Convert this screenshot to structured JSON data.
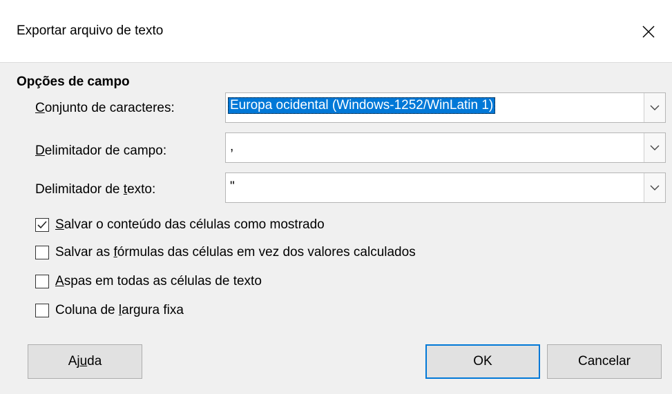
{
  "dialog": {
    "title": "Exportar arquivo de texto",
    "section_title": "Opções de campo"
  },
  "fields": [
    {
      "label_pre": "",
      "label_u": "C",
      "label_post": "onjunto de caracteres:",
      "value": "Europa ocidental (Windows-1252/WinLatin 1)"
    },
    {
      "label_pre": "",
      "label_u": "D",
      "label_post": "elimitador de campo:",
      "value": ","
    },
    {
      "label_pre": "Delimitador de ",
      "label_u": "t",
      "label_post": "exto:",
      "value": "\""
    }
  ],
  "options": [
    {
      "pre": "",
      "u": "S",
      "post": "alvar o conteúdo das células como mostrado",
      "checked": true
    },
    {
      "pre": "Salvar as ",
      "u": "f",
      "post": "órmulas das células em vez dos valores calculados",
      "checked": false
    },
    {
      "pre": "",
      "u": "A",
      "post": "spas em todas as células de texto",
      "checked": false
    },
    {
      "pre": "Coluna de ",
      "u": "l",
      "post": "argura fixa",
      "checked": false
    }
  ],
  "buttons": {
    "help_pre": "Aj",
    "help_u": "u",
    "help_post": "da",
    "ok": "OK",
    "cancel": "Cancelar"
  },
  "colors": {
    "selection": "#0078d7",
    "background": "#f0f0f0"
  }
}
